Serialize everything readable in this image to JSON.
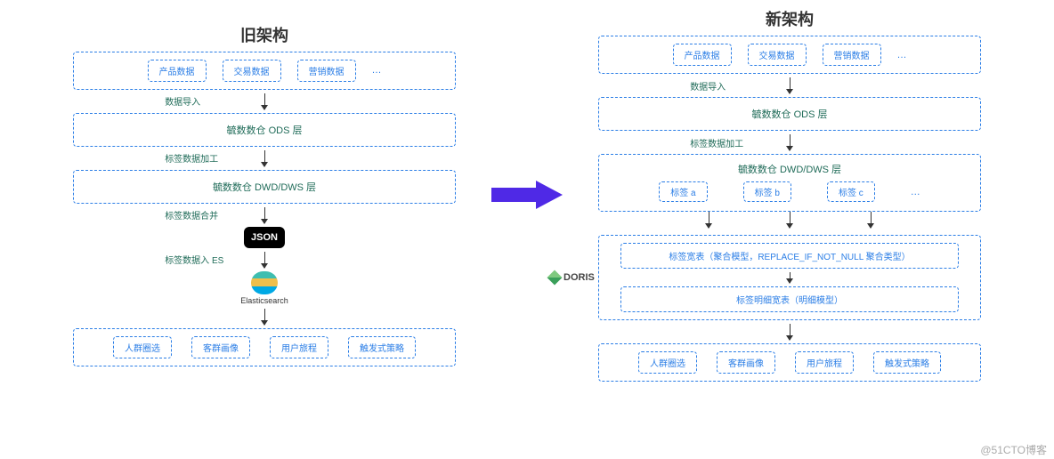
{
  "titles": {
    "left": "旧架构",
    "right": "新架构"
  },
  "sources": {
    "items": [
      "产品数据",
      "交易数据",
      "营销数据"
    ],
    "ellipsis": "…"
  },
  "steps": {
    "import": "数据导入",
    "ods": "毓数数仓 ODS 层",
    "tag_process": "标签数据加工",
    "dwd": "毓数数仓 DWD/DWS 层",
    "tag_merge": "标签数据合并",
    "json": "JSON",
    "to_es": "标签数据入 ES",
    "es": "Elasticsearch"
  },
  "tags": {
    "a": "标签 a",
    "b": "标签 b",
    "c": "标签 c",
    "ellipsis": "…"
  },
  "doris": {
    "name": "DORIS",
    "wide": "标签宽表（聚合模型，REPLACE_IF_NOT_NULL 聚合类型）",
    "detail": "标签明细宽表（明细模型）"
  },
  "outputs": {
    "items": [
      "人群圈选",
      "客群画像",
      "用户旅程",
      "触发式策略"
    ]
  },
  "watermark": "@51CTO博客"
}
